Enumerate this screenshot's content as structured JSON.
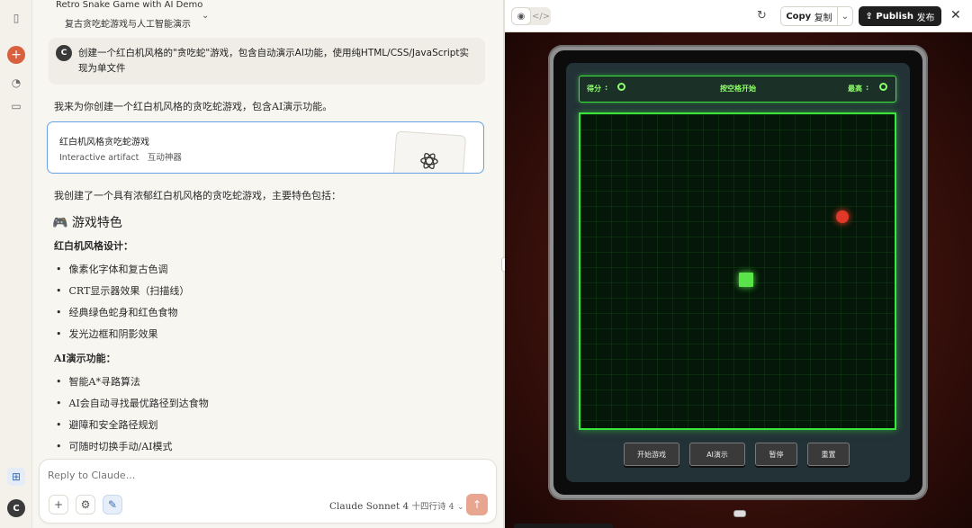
{
  "chat": {
    "title": "Retro Snake Game with AI Demo",
    "subtitle": "复古贪吃蛇游戏与人工智能演示",
    "user_avatar": "C",
    "user_message": "创建一个红白机风格的\"贪吃蛇\"游戏，包含自动演示AI功能，使用纯HTML/CSS/JavaScript实现为单文件",
    "intro": "我来为你创建一个红白机风格的贪吃蛇游戏，包含AI演示功能。",
    "artifact": {
      "title": "红白机风格贪吃蛇游戏",
      "subtitle": "Interactive artifact　互动神器",
      "icon": "atom-icon"
    },
    "summary": "我创建了一个具有浓郁红白机风格的贪吃蛇游戏，主要特色包括：",
    "features_heading": "🎮 游戏特色",
    "style_heading": "红白机风格设计：",
    "style_items": [
      "像素化字体和复古色调",
      "CRT显示器效果（扫描线）",
      "经典绿色蛇身和红色食物",
      "发光边框和阴影效果"
    ],
    "ai_heading": "AI演示功能：",
    "ai_items": [
      "智能A*寻路算法",
      "AI会自动寻找最优路径到达食物",
      "避障和安全路径规划",
      "可随时切换手动/AI模式"
    ]
  },
  "composer": {
    "placeholder": "Reply to Claude...",
    "model": "Claude Sonnet 4",
    "model_note": "十四行诗 4"
  },
  "rail": {
    "avatar": "C"
  },
  "toolbar": {
    "copy_label": "Copy",
    "copy_label_cn": "复制",
    "publish_label": "Publish",
    "publish_label_cn": "发布"
  },
  "game": {
    "score_label": "得分",
    "hint": "按空格开始",
    "high_label": "最高",
    "buttons": [
      "开始游戏",
      "AI演示",
      "暂停",
      "重置"
    ],
    "colors": {
      "snake": "#5ae44a",
      "food": "#e0392a",
      "border": "#3ae63a",
      "cabinet": "#5a1b12"
    }
  }
}
